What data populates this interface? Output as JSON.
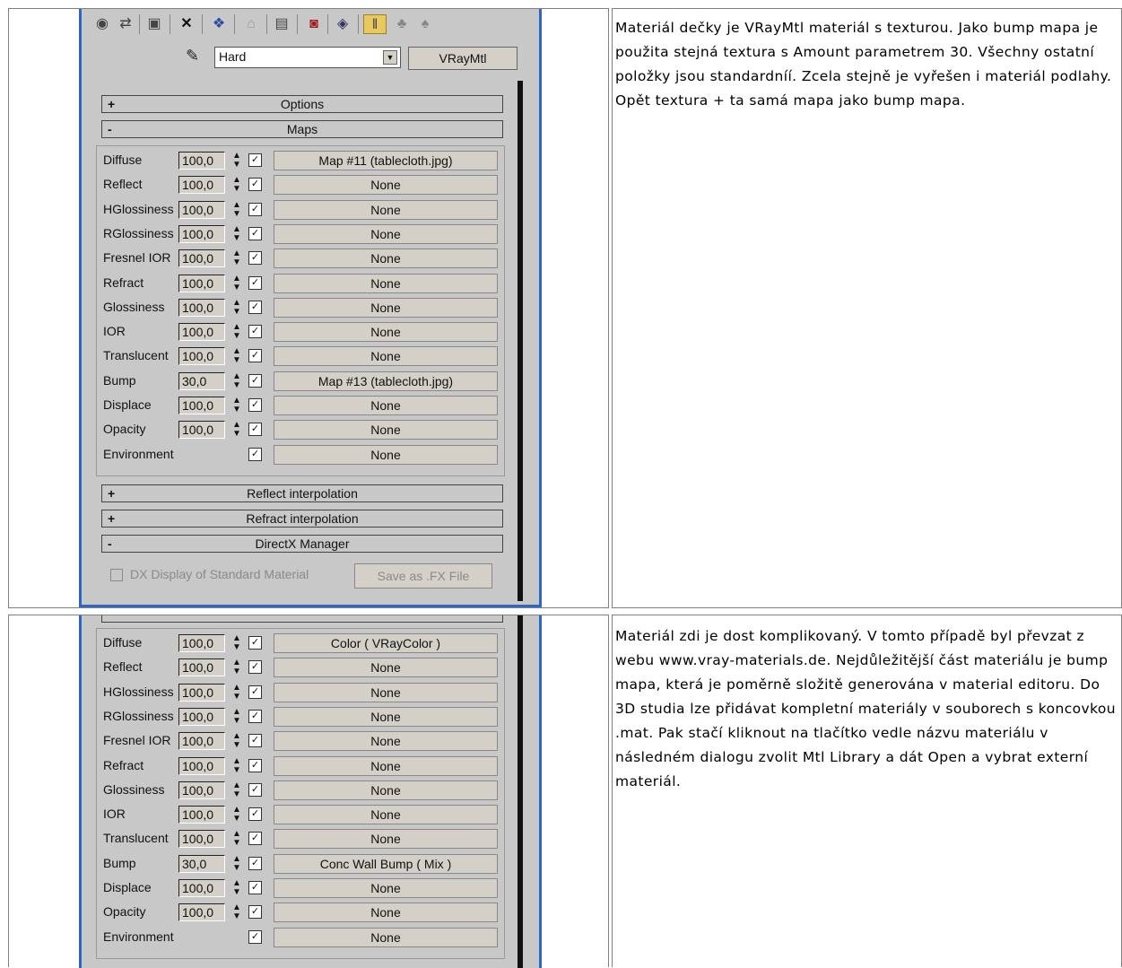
{
  "section1": {
    "toolbar_icons": [
      "get-material-icon",
      "put-to-scene-icon",
      "assign-icon",
      "delete-icon",
      "make-unique-icon",
      "put-library-icon",
      "material-effects-icon",
      "show-map-icon",
      "show-end-result-icon",
      "go-to-parent-icon",
      "go-forward-icon",
      "pick-material-icon"
    ],
    "material_name": "Hard",
    "material_type": "VRayMtl",
    "rollouts_top": [
      {
        "sign": "+",
        "title": "Options"
      },
      {
        "sign": "-",
        "title": "Maps"
      }
    ],
    "maps": [
      {
        "label": "Diffuse",
        "amount": "100,0",
        "map": "Map #11 (tablecloth.jpg)"
      },
      {
        "label": "Reflect",
        "amount": "100,0",
        "map": "None"
      },
      {
        "label": "HGlossiness",
        "amount": "100,0",
        "map": "None"
      },
      {
        "label": "RGlossiness",
        "amount": "100,0",
        "map": "None"
      },
      {
        "label": "Fresnel IOR",
        "amount": "100,0",
        "map": "None"
      },
      {
        "label": "Refract",
        "amount": "100,0",
        "map": "None"
      },
      {
        "label": "Glossiness",
        "amount": "100,0",
        "map": "None"
      },
      {
        "label": "IOR",
        "amount": "100,0",
        "map": "None"
      },
      {
        "label": "Translucent",
        "amount": "100,0",
        "map": "None"
      },
      {
        "label": "Bump",
        "amount": "30,0",
        "map": "Map #13 (tablecloth.jpg)"
      },
      {
        "label": "Displace",
        "amount": "100,0",
        "map": "None"
      },
      {
        "label": "Opacity",
        "amount": "100,0",
        "map": "None"
      },
      {
        "label": "Environment",
        "amount": "",
        "map": "None"
      }
    ],
    "rollouts_bottom": [
      {
        "sign": "+",
        "title": "Reflect interpolation"
      },
      {
        "sign": "+",
        "title": "Refract interpolation"
      },
      {
        "sign": "-",
        "title": "DirectX Manager"
      }
    ],
    "dx_checkbox_label": "DX Display of Standard Material",
    "dx_button_label": "Save as .FX File",
    "description": "Materiál dečky je VRayMtl materiál s texturou. Jako bump mapa je použita stejná textura s Amount parametrem 30. Všechny ostatní položky jsou standardníí. Zcela stejně je vyřešen i materiál podlahy. Opět textura + ta samá mapa jako bump mapa."
  },
  "section2": {
    "maps": [
      {
        "label": "Diffuse",
        "amount": "100,0",
        "map": "Color ( VRayColor )"
      },
      {
        "label": "Reflect",
        "amount": "100,0",
        "map": "None"
      },
      {
        "label": "HGlossiness",
        "amount": "100,0",
        "map": "None"
      },
      {
        "label": "RGlossiness",
        "amount": "100,0",
        "map": "None"
      },
      {
        "label": "Fresnel IOR",
        "amount": "100,0",
        "map": "None"
      },
      {
        "label": "Refract",
        "amount": "100,0",
        "map": "None"
      },
      {
        "label": "Glossiness",
        "amount": "100,0",
        "map": "None"
      },
      {
        "label": "IOR",
        "amount": "100,0",
        "map": "None"
      },
      {
        "label": "Translucent",
        "amount": "100,0",
        "map": "None"
      },
      {
        "label": "Bump",
        "amount": "30,0",
        "map": "Conc Wall Bump ( Mix )"
      },
      {
        "label": "Displace",
        "amount": "100,0",
        "map": "None"
      },
      {
        "label": "Opacity",
        "amount": "100,0",
        "map": "None"
      },
      {
        "label": "Environment",
        "amount": "",
        "map": "None"
      }
    ],
    "description": "Materiál zdi je dost komplikovaný. V tomto případě byl převzat z webu www.vray-materials.de. Nejdůležitější část materiálu je bump mapa, která je poměrně složitě generována v material editoru. Do 3D studia lze přidávat kompletní materiály v souborech s koncovkou .mat. Pak stačí kliknout na tlačítko vedle názvu materiálu v následném dialogu zvolit Mtl Library a dát Open a vybrat externí materiál."
  }
}
